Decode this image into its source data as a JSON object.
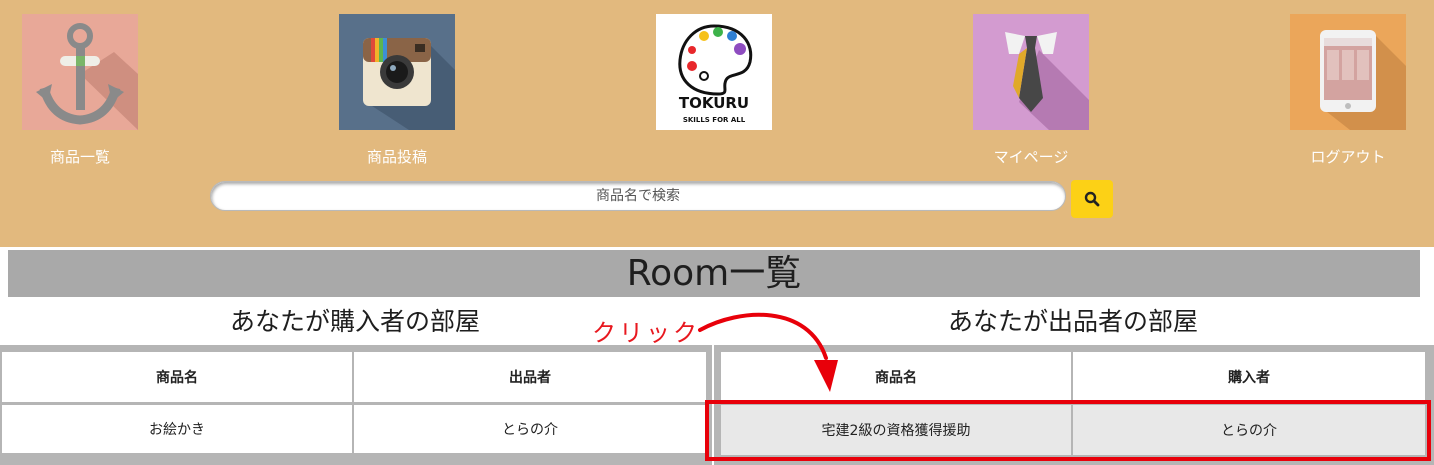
{
  "nav": {
    "items": [
      {
        "label": "商品一覧",
        "icon": "anchor-icon"
      },
      {
        "label": "商品投稿",
        "icon": "camera-icon"
      },
      {
        "label": "",
        "icon": "palette-logo-icon"
      },
      {
        "label": "マイページ",
        "icon": "tie-icon"
      },
      {
        "label": "ログアウト",
        "icon": "tablet-icon"
      }
    ],
    "logo": {
      "name": "TOKURU",
      "tagline": "SKILLS FOR ALL"
    }
  },
  "search": {
    "placeholder": "商品名で検索",
    "button_icon": "search-icon"
  },
  "page": {
    "title": "Room一覧"
  },
  "buyer_rooms": {
    "title": "あなたが購入者の部屋",
    "columns": [
      "商品名",
      "出品者"
    ],
    "rows": [
      {
        "product": "お絵かき",
        "person": "とらの介"
      }
    ]
  },
  "seller_rooms": {
    "title": "あなたが出品者の部屋",
    "columns": [
      "商品名",
      "購入者"
    ],
    "rows": [
      {
        "product": "宅建2級の資格獲得援助",
        "person": "とらの介"
      }
    ]
  },
  "annotation": {
    "text": "クリック"
  },
  "colors": {
    "header_bg": "#e2b97e",
    "search_button": "#fcd116",
    "annotation_red": "#e8000a",
    "title_bar": "#a9a9a9"
  }
}
